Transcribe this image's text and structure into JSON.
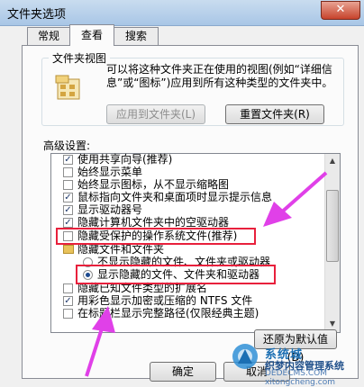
{
  "window": {
    "title": "文件夹选项",
    "close_label": "✕"
  },
  "tabs": [
    {
      "label": "常规"
    },
    {
      "label": "查看"
    },
    {
      "label": "搜索"
    }
  ],
  "folder_view": {
    "title": "文件夹视图",
    "description": "可以将这种文件夹正在使用的视图(例如“详细信息”或“图标”)应用到所有这种类型的文件夹中。",
    "apply_button": "应用到文件夹(L)",
    "reset_button": "重置文件夹(R)"
  },
  "advanced": {
    "label": "高级设置:",
    "items": [
      {
        "label": "使用共享向导(推荐)",
        "checked": true
      },
      {
        "label": "始终显示菜单",
        "checked": false
      },
      {
        "label": "始终显示图标，从不显示缩略图",
        "checked": false
      },
      {
        "label": "鼠标指向文件夹和桌面项时显示提示信息",
        "checked": true
      },
      {
        "label": "显示驱动器号",
        "checked": true
      },
      {
        "label": "隐藏计算机文件夹中的空驱动器",
        "checked": true
      },
      {
        "label": "隐藏受保护的操作系统文件(推荐)",
        "checked": false
      },
      {
        "label": "隐藏文件和文件夹"
      },
      {
        "label": "不显示隐藏的文件、文件夹或驱动器",
        "selected": false
      },
      {
        "label": "显示隐藏的文件、文件夹和驱动器",
        "selected": true
      },
      {
        "label": "隐藏已知文件类型的扩展名",
        "checked": false
      },
      {
        "label": "用彩色显示加密或压缩的 NTFS 文件",
        "checked": true
      },
      {
        "label": "在标题栏显示完整路径(仅限经典主题)",
        "checked": false
      }
    ]
  },
  "restore_defaults_button": "还原为默认值(D)",
  "footer": {
    "ok_button": "确定",
    "cancel_button": "取消"
  },
  "watermark": {
    "line1": "系统城",
    "line2": "织梦内容管理系统",
    "line3": "DEDECMS.COM",
    "line4": "xitongcheng.com"
  },
  "colors": {
    "highlight": "#e8203c",
    "arrow": "#e040e8",
    "accent": "#1d4a8f"
  }
}
